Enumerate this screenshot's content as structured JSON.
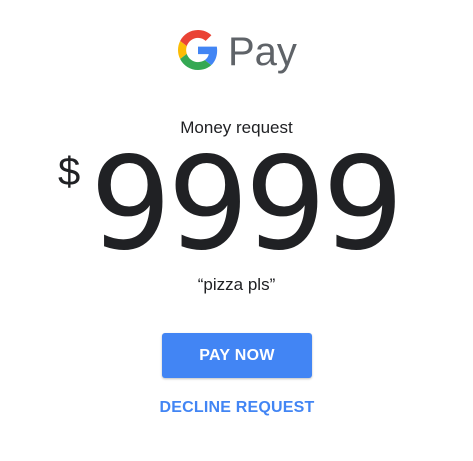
{
  "brand": {
    "logo_word": "Pay",
    "logo_icon": "google-g-icon",
    "colors": {
      "blue": "#4285F4",
      "red": "#EA4335",
      "yellow": "#FBBC05",
      "green": "#34A853",
      "wordmark": "#5F6368"
    }
  },
  "request": {
    "title": "Money request",
    "currency_symbol": "$",
    "amount": "9999",
    "note": "“pizza pls”"
  },
  "actions": {
    "pay_label": "PAY NOW",
    "decline_label": "DECLINE REQUEST",
    "accent_color": "#4285F4"
  }
}
